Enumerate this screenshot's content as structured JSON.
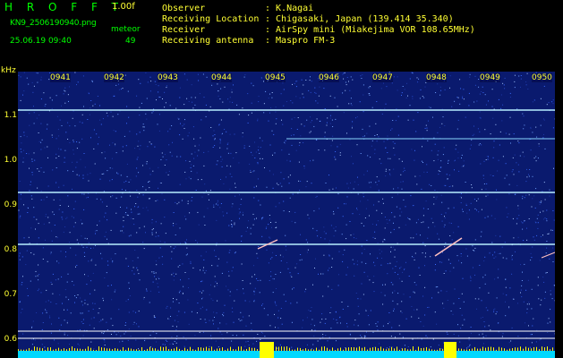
{
  "header": {
    "app_title": "H R O F F T",
    "version": "1.00f",
    "filename": "KN9_2506190940.png",
    "meteor_label": "meteor",
    "datetime": "25.06.19 09:40",
    "meteor_count": "49",
    "info": [
      {
        "label": "Observer",
        "value": ": K.Nagai"
      },
      {
        "label": "Receiving Location",
        "value": ": Chigasaki, Japan (139.414 35.340)"
      },
      {
        "label": "Receiver",
        "value": ": AirSpy mini (Miakejima VOR 108.65MHz)"
      },
      {
        "label": "Receiving antenna",
        "value": ": Maspro FM-3"
      }
    ]
  },
  "axis": {
    "unit": "kHz",
    "y_ticks": [
      "1.1",
      "1.0",
      "0.9",
      "0.8",
      "0.7",
      "0.6"
    ],
    "time_ticks": [
      "0941",
      "0942",
      "0943",
      "0944",
      "0945",
      "0946",
      "0947",
      "0948",
      "0949",
      "0950"
    ]
  },
  "colors": {
    "background": "#000000",
    "spectrogram_bg": "#0a1a6e",
    "header_text": "#00ff00",
    "label_text": "#ffff33",
    "carrier_line": "#b8f0ff",
    "meter_bar": "#00d8ff",
    "meter_peak": "#ffff00"
  }
}
